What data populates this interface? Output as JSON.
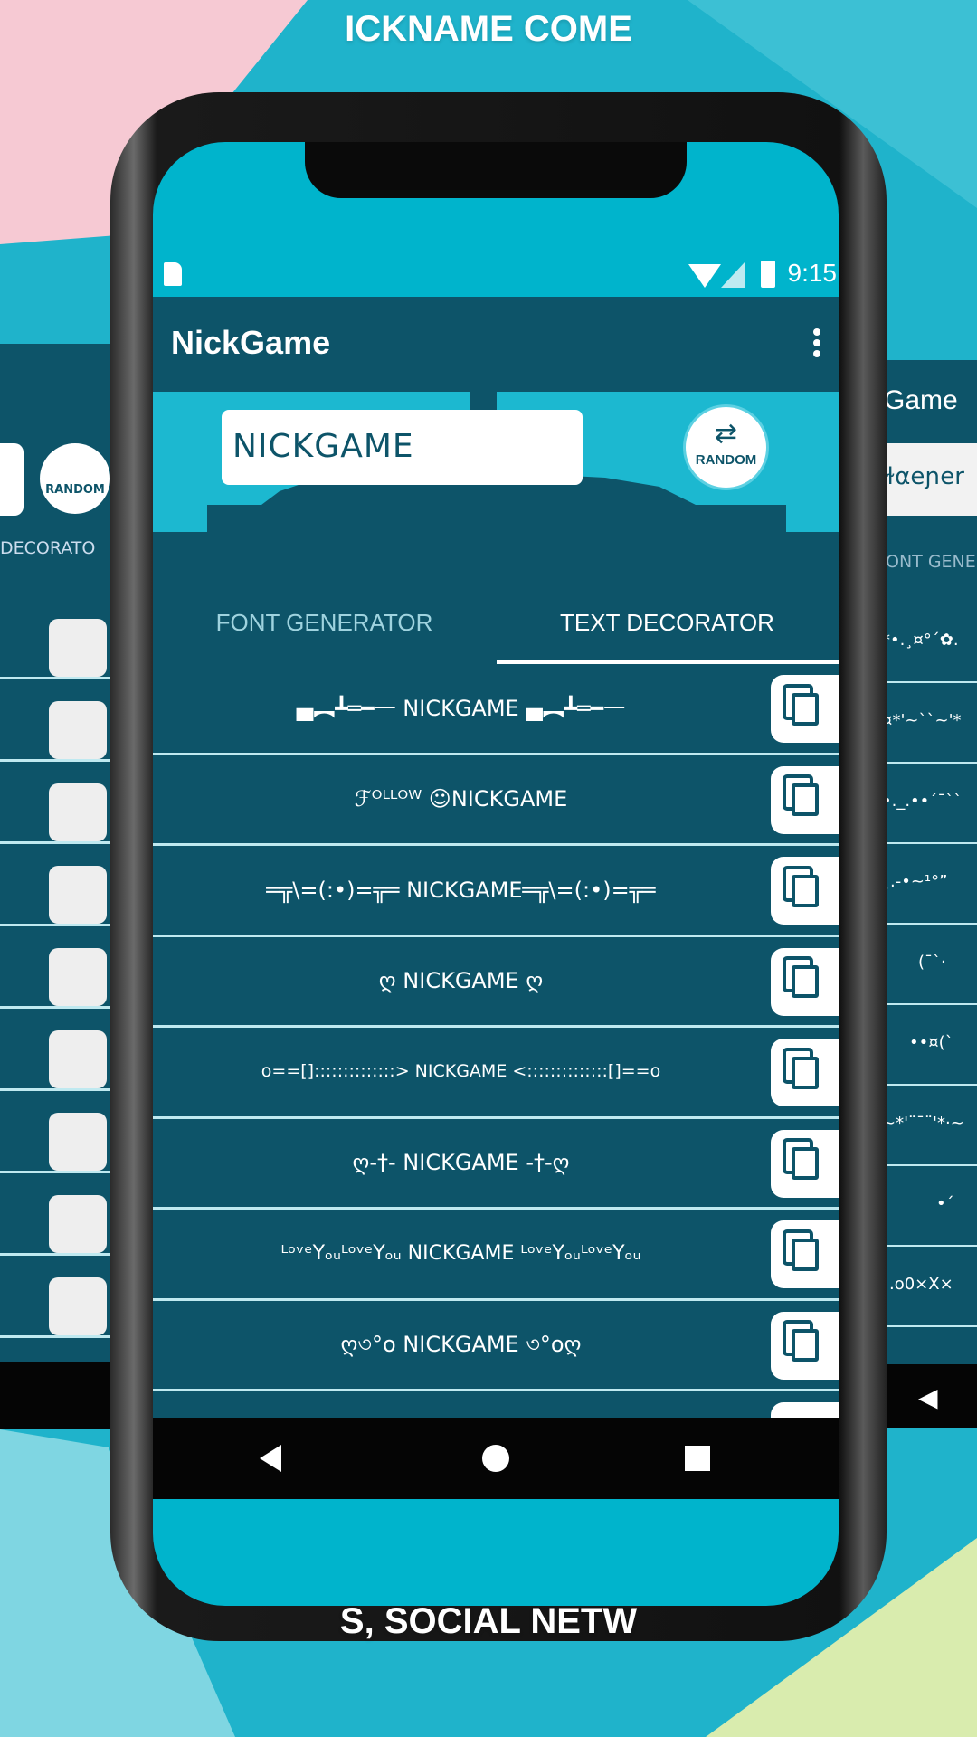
{
  "banner_top": "ICKNAME COME",
  "banner_bottom": "S, SOCIAL NETW",
  "status": {
    "time": "9:15"
  },
  "app": {
    "title": "NickGame",
    "menu_icon": "more-vert-icon"
  },
  "input": {
    "value": "NICKGAME"
  },
  "random": {
    "label": "RANDOM",
    "icon": "shuffle-icon"
  },
  "tabs": [
    {
      "label": "FONT GENERATOR",
      "active": false
    },
    {
      "label": "TEXT DECORATOR",
      "active": true
    }
  ],
  "rows": [
    "▄︻┻═━一 NICKGAME ▄︻┻═━一",
    "ℱᴼᴸᴸᴼᵂ ☺NICKGAME",
    "═╦\\=(:•)=╦═ NICKGAME═╦\\=(:•)=╦═",
    "ღ NICKGAME ღ",
    "o==[]::::::::::::::> NICKGAME <::::::::::::::[]==o",
    "ღ-†- NICKGAME -†-ღ",
    "ᴸᵒᵛᵉYₒᵤᴸᵒᵛᵉYₒᵤ  NICKGAME ᴸᵒᵛᵉYₒᵤᴸᵒᵛᵉYₒᵤ",
    "ღ৩°o NICKGAME ৩°oღ"
  ],
  "copy_icon": "copy-icon",
  "right_panel": {
    "title": "Game",
    "input": "ɫαeɲer",
    "tab": "ONT GENE",
    "rows": [
      "*•.¸¤°´✿.",
      "¤*'~``~'*",
      "•._.••´¯``",
      "¸.-•~¹°”",
      "(¯`·",
      "••¤(`",
      "~*'¨¯¨'*·~",
      "•´",
      ".o0×X×"
    ]
  },
  "left_panel": {
    "tab": "DECORATO",
    "random": "RANDOM"
  },
  "colors": {
    "primary": "#0d5469",
    "accent": "#00b4cc",
    "divider": "#bfe9f0"
  }
}
